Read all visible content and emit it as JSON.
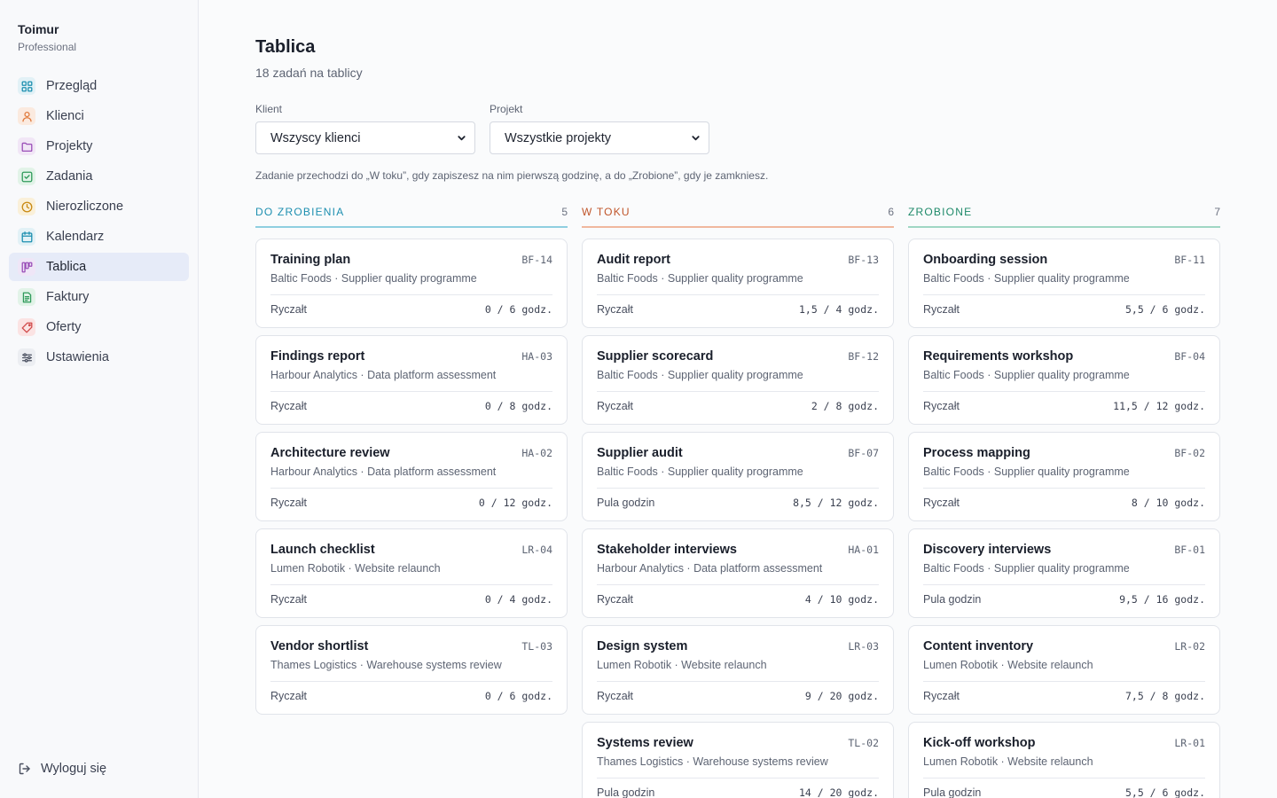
{
  "sidebar": {
    "brand_name": "Toimur",
    "brand_plan": "Professional",
    "items": [
      {
        "label": "Przegląd",
        "icon": "grid-icon",
        "color": "#1d8fb0",
        "bg": "#e2f1f6"
      },
      {
        "label": "Klienci",
        "icon": "user-icon",
        "color": "#e07a3c",
        "bg": "#fbeadf"
      },
      {
        "label": "Projekty",
        "icon": "folder-icon",
        "color": "#9a4fb8",
        "bg": "#f1e6f6"
      },
      {
        "label": "Zadania",
        "icon": "check-square-icon",
        "color": "#2f9a5a",
        "bg": "#e2f3e8"
      },
      {
        "label": "Nierozliczone",
        "icon": "clock-icon",
        "color": "#c98a14",
        "bg": "#faf0d9"
      },
      {
        "label": "Kalendarz",
        "icon": "calendar-icon",
        "color": "#1d8fb0",
        "bg": "#e2f1f6"
      },
      {
        "label": "Tablica",
        "icon": "board-icon",
        "color": "#9a4fb8",
        "bg": "#efe6f7"
      },
      {
        "label": "Faktury",
        "icon": "invoice-icon",
        "color": "#2f9a5a",
        "bg": "#e2f3e8"
      },
      {
        "label": "Oferty",
        "icon": "tag-icon",
        "color": "#d04a4a",
        "bg": "#fbe3e3"
      },
      {
        "label": "Ustawienia",
        "icon": "sliders-icon",
        "color": "#4a5060",
        "bg": "#eceef2"
      }
    ],
    "active_index": 6,
    "logout_label": "Wyloguj się"
  },
  "header": {
    "title": "Tablica",
    "subtitle": "18 zadań na tablicy"
  },
  "filters": {
    "client_label": "Klient",
    "client_value": "Wszyscy klienci",
    "project_label": "Projekt",
    "project_value": "Wszystkie projekty"
  },
  "hint": "Zadanie przechodzi do „W toku”, gdy zapiszesz na nim pierwszą godzinę, a do „Zrobione”, gdy je zamkniesz.",
  "columns": [
    {
      "title": "DO ZROBIENIA",
      "count": "5",
      "color": "#1d8fb0",
      "line": "#8fcfe0",
      "cards": [
        {
          "title": "Training plan",
          "code": "BF-14",
          "client": "Baltic Foods · Supplier quality programme",
          "billing": "Ryczałt",
          "hours": "0 / 6 godz."
        },
        {
          "title": "Findings report",
          "code": "HA-03",
          "client": "Harbour Analytics · Data platform assessment",
          "billing": "Ryczałt",
          "hours": "0 / 8 godz."
        },
        {
          "title": "Architecture review",
          "code": "HA-02",
          "client": "Harbour Analytics · Data platform assessment",
          "billing": "Ryczałt",
          "hours": "0 / 12 godz."
        },
        {
          "title": "Launch checklist",
          "code": "LR-04",
          "client": "Lumen Robotik · Website relaunch",
          "billing": "Ryczałt",
          "hours": "0 / 4 godz."
        },
        {
          "title": "Vendor shortlist",
          "code": "TL-03",
          "client": "Thames Logistics · Warehouse systems review",
          "billing": "Ryczałt",
          "hours": "0 / 6 godz."
        }
      ]
    },
    {
      "title": "W TOKU",
      "count": "6",
      "color": "#c0552a",
      "line": "#f0b89e",
      "cards": [
        {
          "title": "Audit report",
          "code": "BF-13",
          "client": "Baltic Foods · Supplier quality programme",
          "billing": "Ryczałt",
          "hours": "1,5 / 4 godz."
        },
        {
          "title": "Supplier scorecard",
          "code": "BF-12",
          "client": "Baltic Foods · Supplier quality programme",
          "billing": "Ryczałt",
          "hours": "2 / 8 godz."
        },
        {
          "title": "Supplier audit",
          "code": "BF-07",
          "client": "Baltic Foods · Supplier quality programme",
          "billing": "Pula godzin",
          "hours": "8,5 / 12 godz."
        },
        {
          "title": "Stakeholder interviews",
          "code": "HA-01",
          "client": "Harbour Analytics · Data platform assessment",
          "billing": "Ryczałt",
          "hours": "4 / 10 godz."
        },
        {
          "title": "Design system",
          "code": "LR-03",
          "client": "Lumen Robotik · Website relaunch",
          "billing": "Ryczałt",
          "hours": "9 / 20 godz."
        },
        {
          "title": "Systems review",
          "code": "TL-02",
          "client": "Thames Logistics · Warehouse systems review",
          "billing": "Pula godzin",
          "hours": "14 / 20 godz."
        }
      ]
    },
    {
      "title": "ZROBIONE",
      "count": "7",
      "color": "#1f8a6a",
      "line": "#9fd6c4",
      "cards": [
        {
          "title": "Onboarding session",
          "code": "BF-11",
          "client": "Baltic Foods · Supplier quality programme",
          "billing": "Ryczałt",
          "hours": "5,5 / 6 godz."
        },
        {
          "title": "Requirements workshop",
          "code": "BF-04",
          "client": "Baltic Foods · Supplier quality programme",
          "billing": "Ryczałt",
          "hours": "11,5 / 12 godz."
        },
        {
          "title": "Process mapping",
          "code": "BF-02",
          "client": "Baltic Foods · Supplier quality programme",
          "billing": "Ryczałt",
          "hours": "8 / 10 godz."
        },
        {
          "title": "Discovery interviews",
          "code": "BF-01",
          "client": "Baltic Foods · Supplier quality programme",
          "billing": "Pula godzin",
          "hours": "9,5 / 16 godz."
        },
        {
          "title": "Content inventory",
          "code": "LR-02",
          "client": "Lumen Robotik · Website relaunch",
          "billing": "Ryczałt",
          "hours": "7,5 / 8 godz."
        },
        {
          "title": "Kick-off workshop",
          "code": "LR-01",
          "client": "Lumen Robotik · Website relaunch",
          "billing": "Pula godzin",
          "hours": "5,5 / 6 godz."
        }
      ]
    }
  ]
}
